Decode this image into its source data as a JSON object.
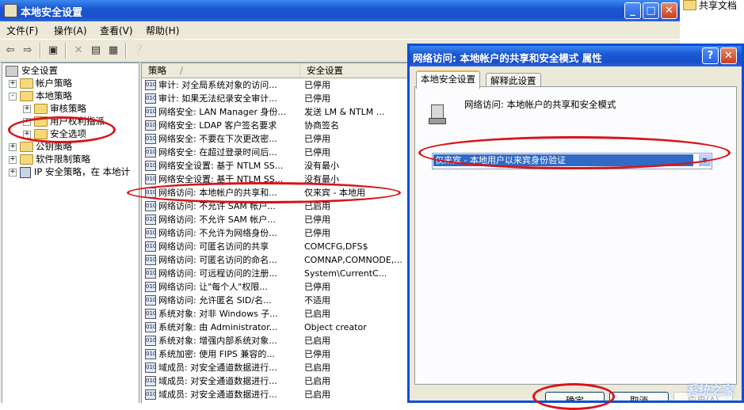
{
  "window": {
    "title": "本地安全设置"
  },
  "menu": [
    "文件(F)",
    "操作(A)",
    "查看(V)",
    "帮助(H)"
  ],
  "tree": [
    {
      "label": "安全设置",
      "level": 0,
      "exp": ""
    },
    {
      "label": "帐户策略",
      "level": 1,
      "exp": "+"
    },
    {
      "label": "本地策略",
      "level": 1,
      "exp": "-"
    },
    {
      "label": "审核策略",
      "level": 2,
      "exp": "+"
    },
    {
      "label": "用户权利指派",
      "level": 2,
      "exp": "+"
    },
    {
      "label": "安全选项",
      "level": 2,
      "exp": "+"
    },
    {
      "label": "公钥策略",
      "level": 1,
      "exp": "+"
    },
    {
      "label": "软件限制策略",
      "level": 1,
      "exp": "+"
    },
    {
      "label": "IP 安全策略，在 本地计",
      "level": 1,
      "exp": "+"
    }
  ],
  "list": {
    "headers": {
      "policy": "策略",
      "setting": "安全设置"
    },
    "rows": [
      {
        "policy": "审计: 对全局系统对象的访问...",
        "setting": "已停用"
      },
      {
        "policy": "审计: 如果无法纪录安全审计...",
        "setting": "已停用"
      },
      {
        "policy": "网络安全: LAN Manager 身份...",
        "setting": "发送 LM & NTLM ..."
      },
      {
        "policy": "网络安全: LDAP 客户签名要求",
        "setting": "协商签名"
      },
      {
        "policy": "网络安全: 不要在下次更改密...",
        "setting": "已停用"
      },
      {
        "policy": "网络安全: 在超过登录时间后...",
        "setting": "已停用"
      },
      {
        "policy": "网络安全设置: 基于 NTLM SS...",
        "setting": "没有最小"
      },
      {
        "policy": "网络安全设置: 基于 NTLM SS...",
        "setting": "没有最小"
      },
      {
        "policy": "网络访问: 本地帐户的共享和...",
        "setting": "仅来宾 - 本地用"
      },
      {
        "policy": "网络访问: 不允许 SAM 帐户...",
        "setting": "已启用"
      },
      {
        "policy": "网络访问: 不允许 SAM 帐户...",
        "setting": "已停用"
      },
      {
        "policy": "网络访问: 不允许为网络身份...",
        "setting": "已停用"
      },
      {
        "policy": "网络访问: 可匿名访问的共享",
        "setting": "COMCFG,DFS$"
      },
      {
        "policy": "网络访问: 可匿名访问的命名...",
        "setting": "COMNAP,COMNODE,..."
      },
      {
        "policy": "网络访问: 可远程访问的注册...",
        "setting": "System\\CurrentC..."
      },
      {
        "policy": "网络访问: 让\"每个人\"权限...",
        "setting": "已停用"
      },
      {
        "policy": "网络访问: 允许匿名 SID/名...",
        "setting": "不适用"
      },
      {
        "policy": "系统对象: 对非 Windows 子...",
        "setting": "已启用"
      },
      {
        "policy": "系统对象: 由 Administrator...",
        "setting": "Object creator"
      },
      {
        "policy": "系统对象: 增强内部系统对象...",
        "setting": "已启用"
      },
      {
        "policy": "系统加密: 使用 FIPS 兼容的...",
        "setting": "已停用"
      },
      {
        "policy": "域成员: 对安全通道数据进行...",
        "setting": "已启用"
      },
      {
        "policy": "域成员: 对安全通道数据进行...",
        "setting": "已启用"
      },
      {
        "policy": "域成员: 对安全通道数据进行...",
        "setting": "已启用"
      }
    ]
  },
  "desktop": {
    "label": "共享文档"
  },
  "dialog": {
    "title": "网络访问: 本地帐户的共享和安全模式 属性",
    "help": "?",
    "tabs": [
      "本地安全设置",
      "解释此设置"
    ],
    "policy_name": "网络访问: 本地帐户的共享和安全模式",
    "combo_value": "仅来宾 - 本地用户以来宾身份验证",
    "buttons": {
      "ok": "确定",
      "cancel": "取消",
      "apply": "应用(A)"
    }
  },
  "watermark": "系统之家",
  "colors": {
    "title_blue": "#1b57d3",
    "highlight": "#316ac5",
    "annotation_red": "#d8141a"
  }
}
